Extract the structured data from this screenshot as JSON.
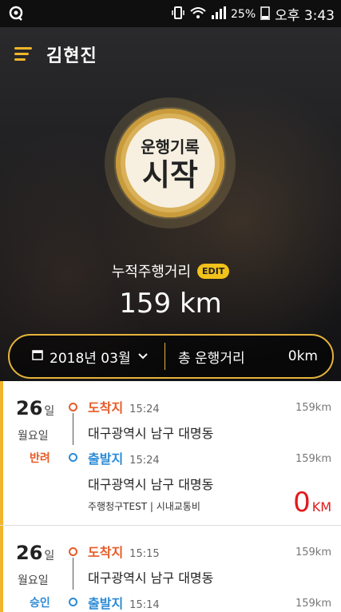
{
  "status_bar": {
    "battery": "25%",
    "time": "오후 3:43"
  },
  "header": {
    "username": "김현진"
  },
  "start_button": {
    "line1": "운행기록",
    "line2": "시작"
  },
  "cumulative": {
    "label": "누적주행거리",
    "edit": "EDIT",
    "value": "159 km"
  },
  "period": {
    "month": "2018년 03월",
    "total_label": "총 운행거리",
    "total_value": "0km"
  },
  "records": [
    {
      "day": "26",
      "day_unit": "일",
      "weekday": "월요일",
      "status": "반려",
      "dest_label": "도착지",
      "dest_time": "15:24",
      "dest_km": "159km",
      "dest_addr": "대구광역시 남구 대명동",
      "origin_label": "출발지",
      "origin_time": "15:24",
      "origin_km": "159km",
      "origin_addr": "대구광역시 남구 대명동",
      "meta": "주행청구TEST | 시내교통비",
      "distance": "0",
      "distance_unit": "KM"
    },
    {
      "day": "26",
      "day_unit": "일",
      "weekday": "월요일",
      "status": "승인",
      "dest_label": "도착지",
      "dest_time": "15:15",
      "dest_km": "159km",
      "dest_addr": "대구광역시 남구 대명동",
      "origin_label": "출발지",
      "origin_time": "15:14",
      "origin_km": "159km"
    }
  ]
}
